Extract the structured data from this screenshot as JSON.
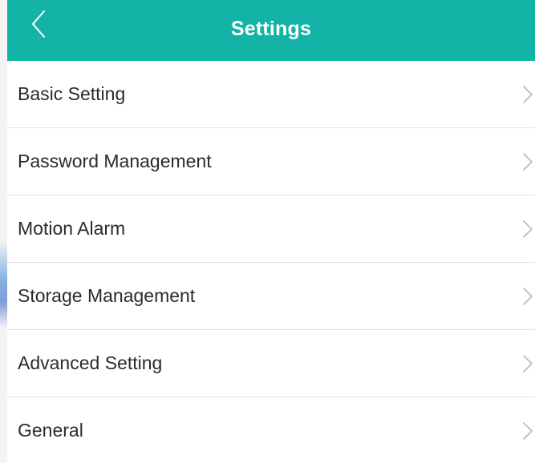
{
  "header": {
    "title": "Settings",
    "back_icon": "chevron-left-icon",
    "background_color": "#14b3a8"
  },
  "menu": {
    "items": [
      {
        "label": "Basic Setting",
        "icon": "chevron-right-icon"
      },
      {
        "label": "Password Management",
        "icon": "chevron-right-icon"
      },
      {
        "label": "Motion Alarm",
        "icon": "chevron-right-icon"
      },
      {
        "label": "Storage Management",
        "icon": "chevron-right-icon"
      },
      {
        "label": "Advanced Setting",
        "icon": "chevron-right-icon"
      },
      {
        "label": "General",
        "icon": "chevron-right-icon"
      }
    ]
  }
}
